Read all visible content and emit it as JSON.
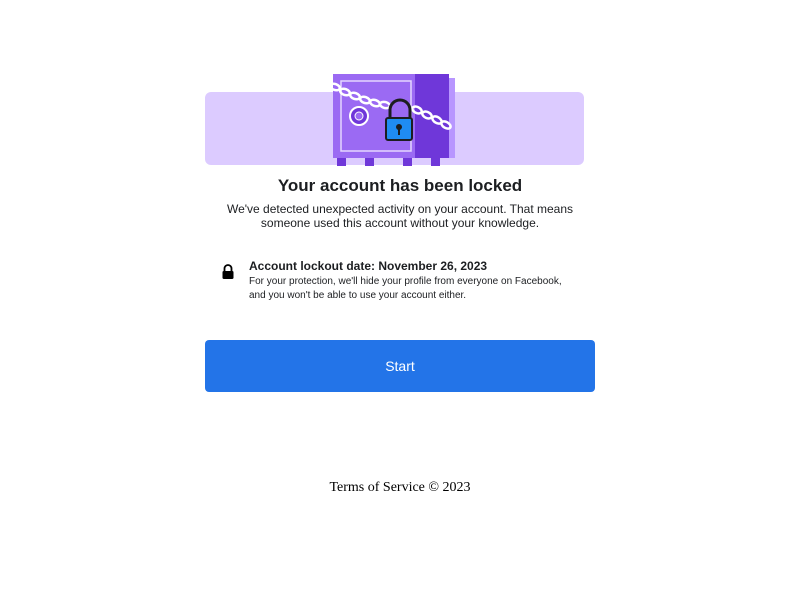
{
  "hero": {
    "illustration_icon": "locked-safe-illustration",
    "colors": {
      "band": "#dccbff",
      "safe": "#9b6af3",
      "safe_door": "#6f37d9",
      "lock": "#1f8cf2"
    }
  },
  "page": {
    "title": "Your account has been locked",
    "subtitle_line1": "We've detected unexpected activity on your account. That means",
    "subtitle_line2": "someone used this account without your knowledge."
  },
  "notice": {
    "icon": "lock-icon",
    "heading": "Account lockout date: November 26, 2023",
    "body_line1": "For your protection, we'll hide your profile from everyone on Facebook,",
    "body_line2": "and you won't be able to use your account either."
  },
  "actions": {
    "start_label": "Start",
    "accent_color": "#2374e8"
  },
  "footer": {
    "text": "Terms of Service © 2023"
  }
}
